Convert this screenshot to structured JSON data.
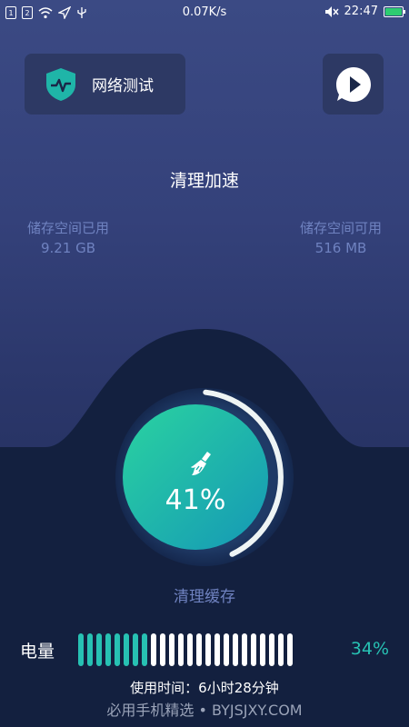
{
  "status_bar": {
    "sim1": "1",
    "sim2": "2",
    "speed": "0.07K/s",
    "time": "22:47"
  },
  "header": {
    "network_test_label": "网络测试",
    "shield_icon": "shield-pulse-icon",
    "play_icon": "play-bubble-icon"
  },
  "main": {
    "title": "清理加速",
    "storage_used_label": "储存空间已用",
    "storage_used_value": "9.21 GB",
    "storage_free_label": "储存空间可用",
    "storage_free_value": "516 MB",
    "gauge_percent": "41%",
    "gauge_progress": 0.41,
    "cache_label": "清理缓存"
  },
  "power": {
    "label": "电量",
    "percent": "34%",
    "level": 0.34,
    "usage_time": "使用时间：6小时28分钟"
  },
  "watermark": "必用手机精选 • BYJSJXY.COM",
  "colors": {
    "accent": "#27c1b3",
    "muted_text": "#6f82c0",
    "gauge_start": "#27c9a4",
    "gauge_end": "#16a0b3"
  }
}
